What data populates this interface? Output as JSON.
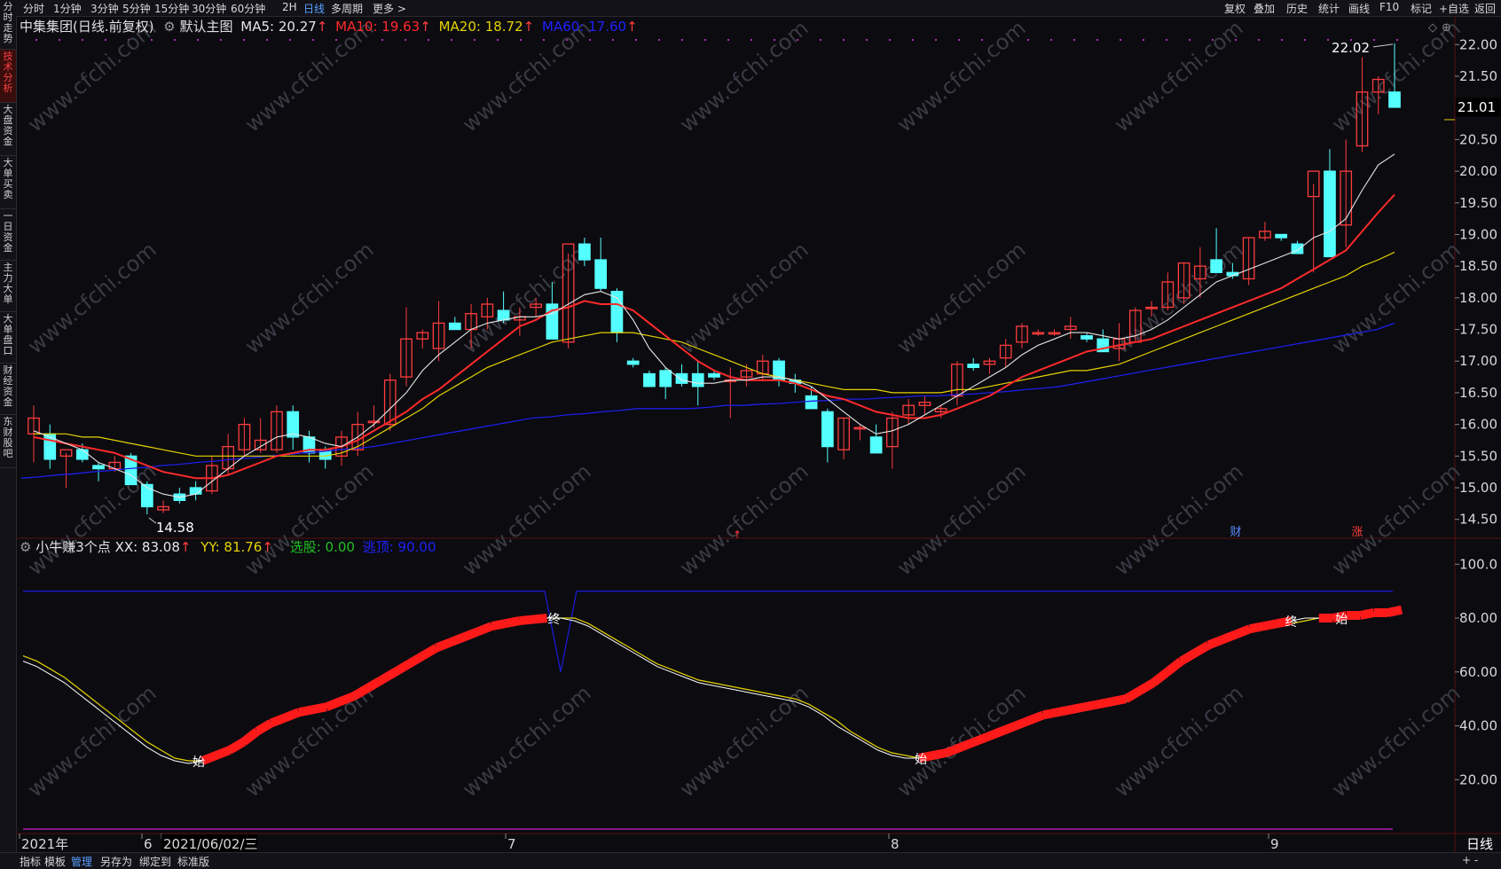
{
  "left_tabs": [
    "分时走势",
    "技术分析",
    "大盘资金",
    "大单买卖",
    "一日资金",
    "主力大单",
    "大单盘口",
    "财经资金",
    "东财股吧"
  ],
  "toolbar": {
    "periods": [
      "分时",
      "1分钟",
      "3分钟",
      "5分钟",
      "15分钟",
      "30分钟",
      "60分钟",
      "2H",
      "日线",
      "多周期",
      "更多 >"
    ],
    "selected_period": "日线",
    "right": [
      "复权",
      "叠加",
      "历史",
      "统计",
      "画线",
      "F10",
      "标记",
      "+自选",
      "返回"
    ]
  },
  "main_legend": {
    "title": "中集集团(日线.前复权)",
    "template": "默认主图",
    "ma5": "MA5: 20.27",
    "ma10": "MA10: 19.63",
    "ma20": "MA20: 18.72",
    "ma60": "MA60: 17.60",
    "arrow": "↑"
  },
  "indicator_legend": {
    "name": "小牛赚3个点",
    "xx": "XX: 83.08",
    "yy": "YY: 81.76",
    "xg": "选股: 0.00",
    "tp": "逃顶: 90.00",
    "arrow": "↑"
  },
  "price_axis": [
    "22.00",
    "21.50",
    "21.01",
    "20.50",
    "20.00",
    "19.50",
    "19.00",
    "18.50",
    "18.00",
    "17.50",
    "17.00",
    "16.50",
    "16.00",
    "15.50",
    "15.00",
    "14.50"
  ],
  "last_price": "21.01",
  "high_label": "22.02",
  "low_label": "14.58",
  "indicator_axis": [
    "100.0",
    "80.00",
    "60.00",
    "40.00",
    "20.00"
  ],
  "event_markers": [
    "财",
    "涨"
  ],
  "signal_labels": {
    "start": "始",
    "end": "终"
  },
  "date_axis": [
    "2021年",
    "6",
    "2021/06/02/三",
    "7",
    "8",
    "9"
  ],
  "period_label": "日线",
  "bottom_tabs": [
    "指标",
    "模板",
    "管理",
    "另存为",
    "绑定到",
    "标准版"
  ],
  "bottom_selected": "管理",
  "watermark": "www.cfchi.com",
  "colors": {
    "up": "#ff3c3c",
    "down": "#54ffff",
    "ma5": "#e6e6e6",
    "ma10": "#ff2a2a",
    "ma20": "#e6d200",
    "ma60": "#1e1ee6",
    "xx": "#ffffff",
    "yy": "#e6d200",
    "tp": "#1a1ad0",
    "bg": "#0b0b10"
  },
  "chart_data": [
    {
      "type": "candlestick",
      "title": "中集集团(日线.前复权)",
      "ylim": [
        14.3,
        22.2
      ],
      "candles": [
        [
          15.85,
          16.3,
          15.4,
          16.1
        ],
        [
          15.85,
          16.0,
          15.3,
          15.45
        ],
        [
          15.5,
          15.55,
          15.0,
          15.6
        ],
        [
          15.6,
          15.7,
          15.4,
          15.45
        ],
        [
          15.35,
          15.4,
          15.1,
          15.3
        ],
        [
          15.3,
          15.5,
          15.25,
          15.4
        ],
        [
          15.5,
          15.55,
          15.05,
          15.05
        ],
        [
          15.05,
          15.1,
          14.58,
          14.7
        ],
        [
          14.65,
          14.8,
          14.6,
          14.7
        ],
        [
          14.9,
          15.0,
          14.75,
          14.8
        ],
        [
          15.0,
          15.1,
          14.8,
          14.9
        ],
        [
          14.95,
          15.5,
          14.9,
          15.35
        ],
        [
          15.3,
          15.85,
          15.2,
          15.65
        ],
        [
          15.6,
          16.1,
          15.5,
          16.0
        ],
        [
          15.6,
          16.1,
          15.55,
          15.75
        ],
        [
          15.6,
          16.3,
          15.55,
          16.2
        ],
        [
          16.2,
          16.3,
          15.6,
          15.8
        ],
        [
          15.8,
          15.9,
          15.4,
          15.55
        ],
        [
          15.6,
          15.65,
          15.3,
          15.45
        ],
        [
          15.5,
          15.9,
          15.35,
          15.8
        ],
        [
          15.6,
          16.2,
          15.5,
          16.0
        ],
        [
          16.05,
          16.3,
          15.95,
          16.05
        ],
        [
          16.0,
          16.8,
          15.9,
          16.7
        ],
        [
          16.75,
          17.85,
          16.6,
          17.35
        ],
        [
          17.35,
          17.5,
          17.2,
          17.45
        ],
        [
          17.2,
          17.95,
          17.0,
          17.6
        ],
        [
          17.6,
          17.7,
          17.5,
          17.5
        ],
        [
          17.5,
          17.9,
          17.2,
          17.75
        ],
        [
          17.7,
          18.0,
          17.5,
          17.9
        ],
        [
          17.8,
          18.1,
          17.6,
          17.65
        ],
        [
          17.65,
          17.85,
          17.4,
          17.7
        ],
        [
          17.85,
          18.0,
          17.7,
          17.9
        ],
        [
          17.9,
          18.25,
          17.7,
          17.35
        ],
        [
          17.3,
          18.7,
          17.2,
          18.85
        ],
        [
          18.85,
          18.95,
          18.5,
          18.6
        ],
        [
          18.6,
          18.95,
          18.1,
          18.15
        ],
        [
          18.1,
          18.15,
          17.3,
          17.45
        ],
        [
          17.0,
          17.05,
          16.9,
          16.95
        ],
        [
          16.8,
          16.85,
          16.6,
          16.6
        ],
        [
          16.85,
          16.9,
          16.4,
          16.6
        ],
        [
          16.8,
          16.95,
          16.6,
          16.65
        ],
        [
          16.8,
          17.0,
          16.3,
          16.6
        ],
        [
          16.8,
          16.85,
          16.7,
          16.75
        ],
        [
          16.7,
          16.9,
          16.1,
          16.7
        ],
        [
          16.75,
          16.95,
          16.6,
          16.85
        ],
        [
          16.8,
          17.1,
          16.7,
          17.0
        ],
        [
          17.0,
          17.05,
          16.6,
          16.7
        ],
        [
          16.7,
          16.8,
          16.5,
          16.65
        ],
        [
          16.45,
          16.6,
          16.3,
          16.25
        ],
        [
          16.2,
          16.25,
          15.4,
          15.65
        ],
        [
          15.6,
          16.1,
          15.45,
          16.1
        ],
        [
          15.95,
          16.0,
          15.75,
          15.95
        ],
        [
          15.8,
          16.0,
          15.6,
          15.55
        ],
        [
          15.65,
          16.2,
          15.3,
          16.1
        ],
        [
          16.15,
          16.4,
          16.0,
          16.3
        ],
        [
          16.3,
          16.45,
          16.15,
          16.35
        ],
        [
          16.2,
          16.3,
          16.1,
          16.25
        ],
        [
          16.45,
          17.0,
          16.3,
          16.95
        ],
        [
          16.95,
          17.05,
          16.85,
          16.9
        ],
        [
          16.95,
          17.05,
          16.8,
          17.0
        ],
        [
          17.05,
          17.35,
          16.9,
          17.25
        ],
        [
          17.3,
          17.6,
          17.2,
          17.55
        ],
        [
          17.45,
          17.5,
          17.4,
          17.45
        ],
        [
          17.45,
          17.5,
          17.4,
          17.45
        ],
        [
          17.5,
          17.7,
          17.35,
          17.55
        ],
        [
          17.4,
          17.45,
          17.3,
          17.35
        ],
        [
          17.35,
          17.5,
          17.15,
          17.15
        ],
        [
          17.2,
          17.6,
          17.0,
          17.35
        ],
        [
          17.3,
          17.85,
          17.3,
          17.8
        ],
        [
          17.85,
          17.95,
          17.7,
          17.85
        ],
        [
          17.85,
          18.4,
          17.8,
          18.25
        ],
        [
          18.0,
          18.55,
          17.9,
          18.55
        ],
        [
          18.3,
          18.8,
          18.0,
          18.5
        ],
        [
          18.6,
          19.1,
          18.5,
          18.4
        ],
        [
          18.4,
          18.55,
          18.3,
          18.35
        ],
        [
          18.3,
          18.95,
          18.2,
          18.95
        ],
        [
          18.95,
          19.2,
          18.9,
          19.05
        ],
        [
          19.0,
          19.0,
          18.9,
          18.95
        ],
        [
          18.85,
          18.9,
          18.7,
          18.7
        ],
        [
          19.6,
          19.8,
          18.4,
          20.0
        ],
        [
          20.0,
          20.35,
          19.2,
          18.65
        ],
        [
          19.15,
          20.5,
          18.8,
          20.0
        ],
        [
          20.4,
          21.8,
          20.3,
          21.25
        ],
        [
          21.25,
          21.5,
          20.9,
          21.45
        ],
        [
          21.25,
          22.02,
          21.0,
          21.01
        ]
      ],
      "ma5": [
        15.9,
        15.8,
        15.7,
        15.6,
        15.4,
        15.3,
        15.2,
        15.0,
        14.9,
        14.85,
        14.9,
        15.1,
        15.3,
        15.5,
        15.65,
        15.8,
        15.85,
        15.8,
        15.7,
        15.65,
        15.8,
        16.0,
        16.25,
        16.5,
        16.85,
        17.1,
        17.3,
        17.5,
        17.6,
        17.65,
        17.7,
        17.7,
        17.75,
        17.9,
        18.05,
        18.1,
        18.0,
        17.65,
        17.2,
        16.9,
        16.7,
        16.65,
        16.65,
        16.7,
        16.7,
        16.75,
        16.75,
        16.7,
        16.6,
        16.4,
        16.2,
        16.0,
        15.85,
        15.9,
        16.0,
        16.15,
        16.3,
        16.45,
        16.6,
        16.75,
        16.9,
        17.1,
        17.25,
        17.35,
        17.45,
        17.45,
        17.4,
        17.35,
        17.4,
        17.5,
        17.65,
        17.85,
        18.05,
        18.25,
        18.35,
        18.45,
        18.55,
        18.65,
        18.75,
        18.95,
        19.05,
        19.25,
        19.7,
        20.1,
        20.27
      ],
      "ma10": [
        15.8,
        15.75,
        15.7,
        15.65,
        15.6,
        15.55,
        15.45,
        15.35,
        15.25,
        15.2,
        15.15,
        15.15,
        15.2,
        15.3,
        15.4,
        15.5,
        15.55,
        15.6,
        15.6,
        15.65,
        15.75,
        15.9,
        16.05,
        16.2,
        16.4,
        16.55,
        16.75,
        16.95,
        17.15,
        17.35,
        17.55,
        17.65,
        17.8,
        17.85,
        17.95,
        17.9,
        17.9,
        17.8,
        17.6,
        17.4,
        17.2,
        17.0,
        16.85,
        16.75,
        16.7,
        16.7,
        16.7,
        16.65,
        16.55,
        16.45,
        16.4,
        16.3,
        16.2,
        16.15,
        16.1,
        16.1,
        16.15,
        16.25,
        16.35,
        16.45,
        16.6,
        16.75,
        16.85,
        16.95,
        17.05,
        17.15,
        17.2,
        17.25,
        17.3,
        17.35,
        17.45,
        17.55,
        17.65,
        17.75,
        17.85,
        17.95,
        18.05,
        18.15,
        18.3,
        18.45,
        18.6,
        18.75,
        19.05,
        19.35,
        19.63
      ],
      "ma20": [
        15.85,
        15.85,
        15.85,
        15.8,
        15.8,
        15.75,
        15.7,
        15.65,
        15.6,
        15.55,
        15.5,
        15.5,
        15.5,
        15.5,
        15.5,
        15.5,
        15.5,
        15.5,
        15.5,
        15.55,
        15.65,
        15.8,
        15.95,
        16.1,
        16.25,
        16.45,
        16.6,
        16.75,
        16.9,
        17.0,
        17.1,
        17.2,
        17.3,
        17.35,
        17.4,
        17.45,
        17.45,
        17.45,
        17.4,
        17.35,
        17.3,
        17.2,
        17.1,
        17.0,
        16.9,
        16.8,
        16.75,
        16.7,
        16.65,
        16.6,
        16.55,
        16.55,
        16.55,
        16.5,
        16.5,
        16.5,
        16.5,
        16.55,
        16.55,
        16.6,
        16.65,
        16.7,
        16.75,
        16.8,
        16.85,
        16.85,
        16.9,
        16.95,
        17.05,
        17.15,
        17.25,
        17.35,
        17.45,
        17.55,
        17.65,
        17.75,
        17.85,
        17.95,
        18.05,
        18.15,
        18.25,
        18.35,
        18.5,
        18.6,
        18.72
      ],
      "ma60": [
        15.15,
        15.17,
        15.2,
        15.22,
        15.25,
        15.27,
        15.3,
        15.32,
        15.35,
        15.37,
        15.4,
        15.42,
        15.45,
        15.47,
        15.5,
        15.52,
        15.55,
        15.57,
        15.6,
        15.62,
        15.65,
        15.7,
        15.75,
        15.8,
        15.85,
        15.9,
        15.95,
        16.0,
        16.05,
        16.1,
        16.12,
        16.15,
        16.17,
        16.2,
        16.22,
        16.25,
        16.25,
        16.25,
        16.25,
        16.27,
        16.3,
        16.3,
        16.32,
        16.33,
        16.35,
        16.37,
        16.38,
        16.4,
        16.4,
        16.42,
        16.43,
        16.45,
        16.45,
        16.47,
        16.48,
        16.5,
        16.52,
        16.55,
        16.57,
        16.6,
        16.65,
        16.7,
        16.75,
        16.8,
        16.85,
        16.9,
        16.95,
        17.0,
        17.05,
        17.1,
        17.15,
        17.2,
        17.25,
        17.3,
        17.35,
        17.4,
        17.45,
        17.5,
        17.6
      ],
      "max_label": 22.02,
      "min_label": 14.58
    },
    {
      "type": "line",
      "title": "小牛赚3个点",
      "ylim": [
        0,
        108
      ],
      "xx": [
        64,
        62,
        59,
        56,
        52,
        48,
        44,
        40,
        36,
        32,
        29,
        27,
        26,
        27,
        29,
        31,
        34,
        38,
        41,
        43,
        45,
        46,
        47,
        49,
        51,
        54,
        57,
        60,
        63,
        66,
        69,
        71,
        73,
        75,
        77,
        78,
        79,
        79.5,
        80,
        80,
        79,
        77,
        74,
        71,
        68,
        65,
        62,
        60,
        58,
        56,
        55,
        54,
        53,
        52,
        51,
        50,
        49,
        47,
        44,
        40,
        37,
        34,
        31,
        29,
        28,
        28,
        29,
        30,
        32,
        34,
        36,
        38,
        40,
        42,
        44,
        45,
        46,
        47,
        48,
        49,
        50,
        53,
        56,
        60,
        64,
        67,
        70,
        72,
        74,
        76,
        77,
        78,
        79,
        80,
        80,
        80,
        81,
        81,
        82,
        82,
        83.08
      ],
      "yy": [
        66,
        64,
        61,
        58,
        54,
        50,
        46,
        42,
        38,
        34,
        31,
        28,
        27,
        27,
        28,
        30,
        33,
        37,
        40,
        42,
        44,
        46,
        47,
        48,
        50,
        53,
        56,
        59,
        62,
        65,
        68,
        70,
        72,
        74,
        76,
        77,
        78,
        79,
        80,
        80,
        80,
        78,
        75,
        72,
        69,
        66,
        63,
        61,
        59,
        57,
        56,
        55,
        54,
        53,
        52,
        51,
        50,
        48,
        45,
        42,
        38,
        35,
        32,
        30,
        29,
        28,
        28,
        29,
        31,
        33,
        35,
        37,
        39,
        41,
        43,
        44,
        45,
        46,
        47,
        48,
        49,
        52,
        55,
        59,
        63,
        66,
        69,
        71,
        73,
        75,
        76,
        77,
        78,
        79,
        80,
        80,
        80,
        81,
        81,
        81,
        81.76
      ],
      "tp": 90,
      "tp_dip": 60,
      "xg": 0
    }
  ]
}
